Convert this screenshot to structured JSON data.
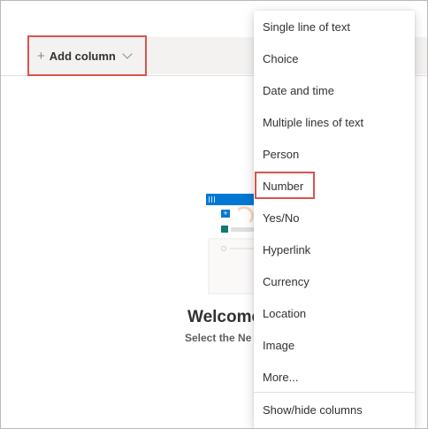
{
  "toolbar": {
    "add_column_label": "Add column",
    "add_icon": "plus-icon",
    "chevron_icon": "chevron-down-icon"
  },
  "welcome": {
    "title": "Welcome",
    "subtitle": "Select the Ne"
  },
  "menu": {
    "items": [
      {
        "label": "Single line of text"
      },
      {
        "label": "Choice"
      },
      {
        "label": "Date and time"
      },
      {
        "label": "Multiple lines of text"
      },
      {
        "label": "Person"
      },
      {
        "label": "Number"
      },
      {
        "label": "Yes/No"
      },
      {
        "label": "Hyperlink"
      },
      {
        "label": "Currency"
      },
      {
        "label": "Location"
      },
      {
        "label": "Image"
      },
      {
        "label": "More..."
      }
    ],
    "footer_item": {
      "label": "Show/hide columns"
    },
    "highlighted_item": "Number"
  },
  "colors": {
    "highlight_border": "#d9534f",
    "accent": "#0078d4",
    "header_bg": "#f3f2f1"
  }
}
